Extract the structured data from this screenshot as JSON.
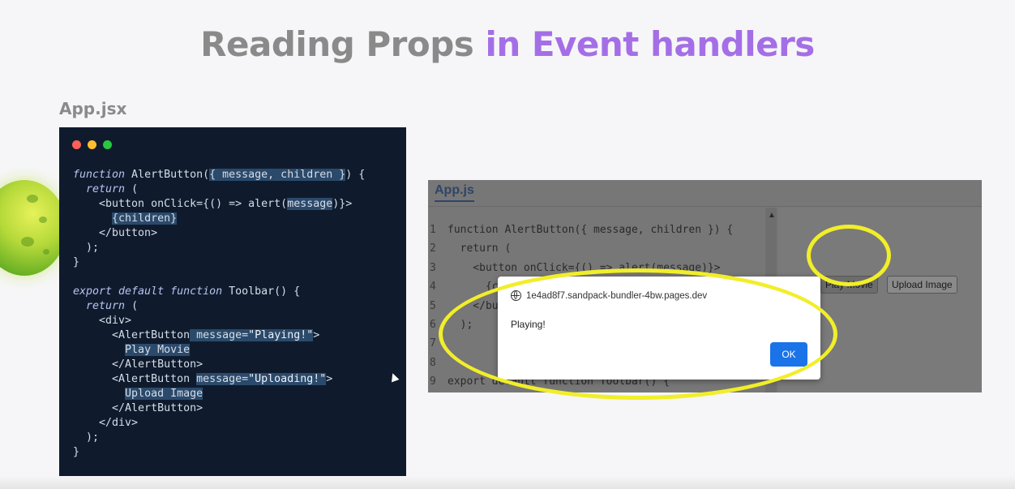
{
  "title": {
    "part1": "Reading Props",
    "part2": "in Event handlers"
  },
  "file_label": "App.jsx",
  "window_dots": [
    "#ff5f57",
    "#febc2e",
    "#28c840"
  ],
  "colors": {
    "title_gray": "#8a8a8a",
    "title_purple": "#a46fe6",
    "code_bg": "#0f1b2d",
    "highlight_ring": "#f1ee2a",
    "ok_button": "#1a73e8"
  },
  "sandbox": {
    "tab": "App.js",
    "line_numbers": [
      "1",
      "2",
      "3",
      "4",
      "5",
      "6",
      "7",
      "8",
      "9"
    ],
    "lines": [
      "function AlertButton({ message, children }) {",
      "  return (",
      "    <button onClick={() => alert(message)}>",
      "      {c",
      "    </bu",
      "  );",
      "",
      "",
      "export default function Toolbar() {"
    ],
    "preview_buttons": [
      "Play Movie",
      "Upload Image"
    ]
  },
  "dialog": {
    "origin": "1e4ad8f7.sandpack-bundler-4bw.pages.dev",
    "message": "Playing!",
    "ok_label": "OK"
  }
}
